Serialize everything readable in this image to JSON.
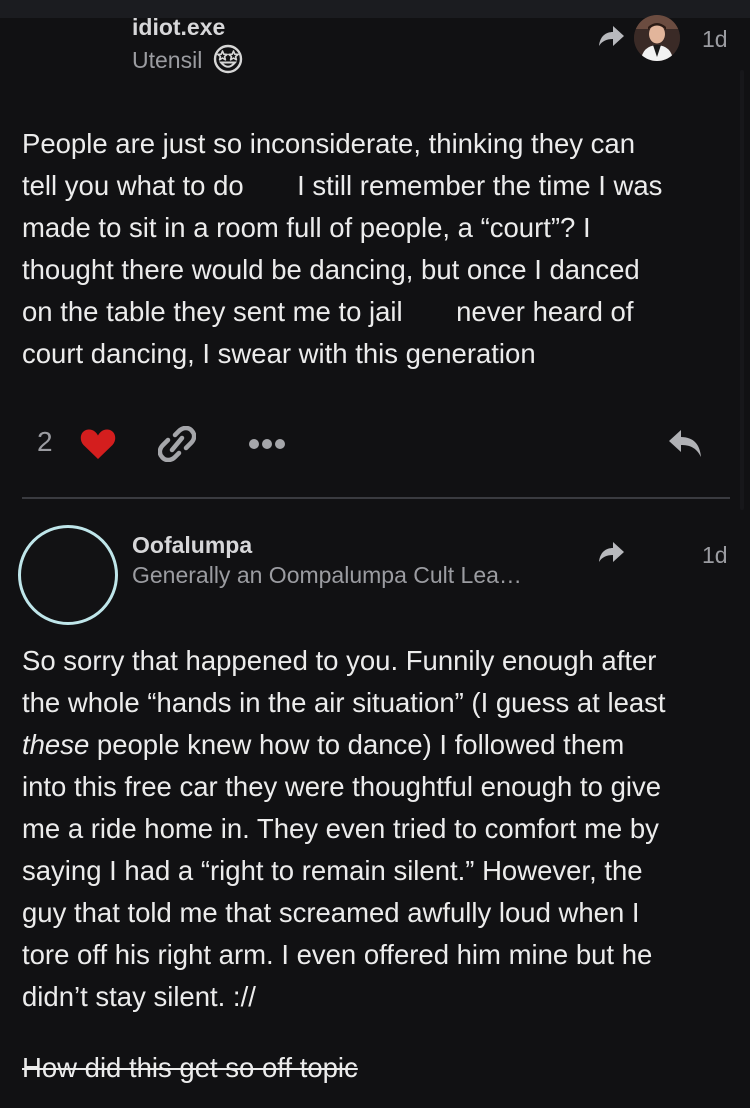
{
  "thread": {
    "posts": [
      {
        "username": "idiot.exe",
        "user_title": "Utensil",
        "title_emoji": "star-struck-emoji",
        "age": "1d",
        "share_icon": "share-arrow-icon",
        "avatar_icon": "reply-to-avatar",
        "body_lines": [
          "People are just so inconsiderate, thinking they can",
          "tell you what to do       I still remember the time I was",
          "made to sit in a room full of people, a “court”? I",
          "thought there would be dancing, but once I danced",
          "on the table they sent me to jail       never heard of",
          "court dancing, I swear with this generation"
        ],
        "like_count": "2",
        "like_color": "#d41e1e",
        "actions": [
          "heart-icon",
          "link-icon",
          "more-icon",
          "reply-icon"
        ]
      },
      {
        "username": "Oofalumpa",
        "user_title": "Generally an Oompalumpa Cult Lea…",
        "age": "1d",
        "share_icon": "share-arrow-icon",
        "avatar_ring_color": "#bfe6ea",
        "body_line_1": "So sorry that happened to you. Funnily enough after",
        "body_line_2": "the whole “hands in the air situation” (I guess at least",
        "body_line_3_em": "these",
        "body_line_3_rest": " people knew how to dance) I followed them",
        "body_line_4": "into this free car they were thoughtful enough to give",
        "body_line_5": "me a ride home in. They even tried to comfort me by",
        "body_line_6": "saying I had a “right to remain silent.” However, the",
        "body_line_7": "guy that told me that screamed awfully loud when I",
        "body_line_8": "tore off his right arm. I even offered him mine but he",
        "body_line_9": "didn’t stay silent. ://",
        "strikethrough_text": "How did this get so off topic"
      }
    ]
  }
}
